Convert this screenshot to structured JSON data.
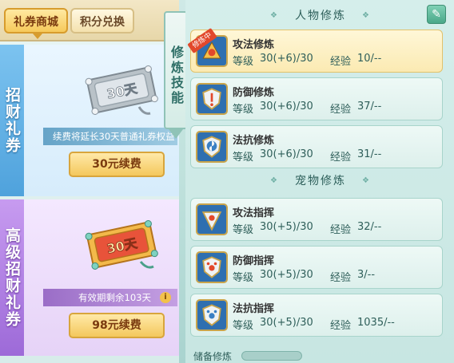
{
  "tabs": [
    {
      "label": "礼券商城"
    },
    {
      "label": "积分兑换"
    }
  ],
  "cards": [
    {
      "vertical_label": "招财礼券",
      "ticket_text": "30天",
      "info": "续费将延长30天普通礼券权益",
      "button": "30元续费"
    },
    {
      "vertical_label": "高级招财礼券",
      "ticket_text": "30天",
      "info": "有效期剩余103天",
      "info_icon": "i",
      "button": "98元续费"
    }
  ],
  "skill_tab": "修炼技能",
  "sections": {
    "character_title": "人物修炼",
    "pet_title": "宠物修炼"
  },
  "edit_icon": "✎",
  "colors": {
    "accent_gold": "#f4c85d",
    "selected_row": "#fbeab2",
    "row_bg": "#ddf0ec",
    "ribbon_red": "#e2482b"
  },
  "level_label": "等级",
  "exp_label": "经验",
  "character_rows": [
    {
      "name": "攻法修炼",
      "level": "30(+6)/30",
      "exp": "10/--",
      "selected": true,
      "ribbon": "修炼中",
      "icon": "attack-magic-icon"
    },
    {
      "name": "防御修炼",
      "level": "30(+6)/30",
      "exp": "37/--",
      "selected": false,
      "icon": "defense-icon"
    },
    {
      "name": "法抗修炼",
      "level": "30(+6)/30",
      "exp": "31/--",
      "selected": false,
      "icon": "magic-resist-icon"
    }
  ],
  "pet_rows": [
    {
      "name": "攻法指挥",
      "level": "30(+5)/30",
      "exp": "32/--",
      "icon": "pet-attack-icon"
    },
    {
      "name": "防御指挥",
      "level": "30(+5)/30",
      "exp": "3/--",
      "icon": "pet-defense-icon"
    },
    {
      "name": "法抗指挥",
      "level": "30(+5)/30",
      "exp": "1035/--",
      "icon": "pet-resist-icon"
    }
  ],
  "bottom": {
    "label": "储备修炼"
  }
}
